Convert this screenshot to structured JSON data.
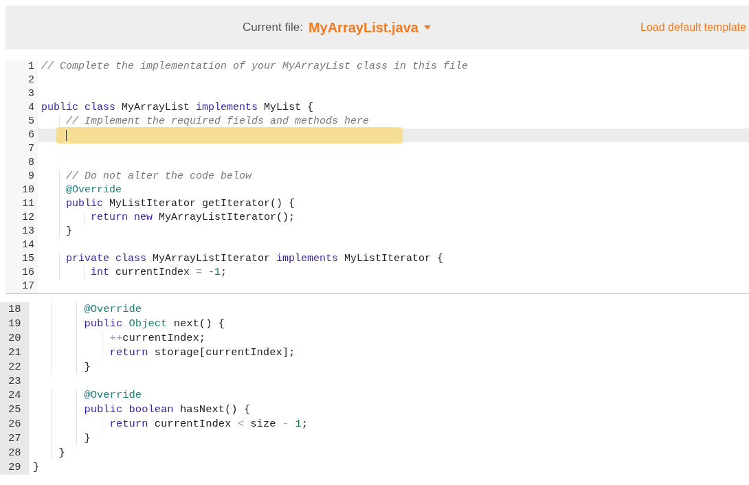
{
  "editor": {
    "current_file_label": "Current file:",
    "file_name": "MyArrayList.java",
    "template_link": "Load default template",
    "lines": [
      {
        "number": "1",
        "active": false,
        "highlighted": false,
        "tokens": [
          {
            "kind": "comment",
            "text": "// Complete the implementation of your MyArrayList class in this file"
          }
        ]
      },
      {
        "number": "2",
        "active": false,
        "highlighted": false
      },
      {
        "number": "3",
        "active": false,
        "highlighted": false
      },
      {
        "number": "4",
        "active": false,
        "highlighted": false,
        "tokens": [
          {
            "kind": "keyword",
            "text": "public class"
          },
          {
            "kind": "plain",
            "text": " MyArrayList "
          },
          {
            "kind": "keyword",
            "text": "implements"
          },
          {
            "kind": "plain",
            "text": " MyList {"
          }
        ]
      },
      {
        "number": "5",
        "active": false,
        "highlighted": false,
        "tokens": [
          {
            "kind": "comment",
            "text": "    // Implement the required fields and methods here"
          }
        ]
      },
      {
        "number": "6",
        "active": true,
        "highlighted": true
      },
      {
        "number": "7",
        "active": false,
        "highlighted": false
      },
      {
        "number": "8",
        "active": false,
        "highlighted": false
      },
      {
        "number": "9",
        "active": false,
        "highlighted": false,
        "tokens": [
          {
            "kind": "comment",
            "text": "    // Do not alter the code below"
          }
        ]
      },
      {
        "number": "10",
        "active": false,
        "highlighted": false,
        "tokens": [
          {
            "kind": "annotation",
            "text": "    @Override"
          }
        ]
      },
      {
        "number": "11",
        "active": false,
        "highlighted": false,
        "tokens": [
          {
            "kind": "keyword",
            "text": "    public"
          },
          {
            "kind": "plain",
            "text": " MyListIterator getIterator() {"
          }
        ]
      },
      {
        "number": "12",
        "active": false,
        "highlighted": false,
        "tokens": [
          {
            "kind": "keyword",
            "text": "        return new"
          },
          {
            "kind": "plain",
            "text": " MyArrayListIterator();"
          }
        ]
      },
      {
        "number": "13",
        "active": false,
        "highlighted": false,
        "tokens": [
          {
            "kind": "plain",
            "text": "    }"
          }
        ]
      },
      {
        "number": "14",
        "active": false,
        "highlighted": false
      },
      {
        "number": "15",
        "active": false,
        "highlighted": false,
        "tokens": [
          {
            "kind": "keyword",
            "text": "    private class"
          },
          {
            "kind": "plain",
            "text": " MyArrayListIterator "
          },
          {
            "kind": "keyword",
            "text": "implements"
          },
          {
            "kind": "plain",
            "text": " MyListIterator {"
          }
        ]
      },
      {
        "number": "16",
        "active": false,
        "highlighted": false,
        "tokens": [
          {
            "kind": "keyword",
            "text": "        int"
          },
          {
            "kind": "plain",
            "text": " currentIndex "
          },
          {
            "kind": "operator",
            "text": "= "
          },
          {
            "kind": "number",
            "text": "-1"
          },
          {
            "kind": "plain",
            "text": ";"
          }
        ]
      },
      {
        "number": "17",
        "active": false,
        "highlighted": false
      }
    ]
  },
  "continued_editor": {
    "lines": [
      {
        "number": "18",
        "tokens": [
          {
            "kind": "annotation",
            "text": "        @Override"
          }
        ]
      },
      {
        "number": "19",
        "tokens": [
          {
            "kind": "keyword",
            "text": "        public "
          },
          {
            "kind": "builtin",
            "text": "Object"
          },
          {
            "kind": "plain",
            "text": " next() {"
          }
        ]
      },
      {
        "number": "20",
        "tokens": [
          {
            "kind": "operator",
            "text": "            ++"
          },
          {
            "kind": "plain",
            "text": "currentIndex;"
          }
        ]
      },
      {
        "number": "21",
        "tokens": [
          {
            "kind": "keyword",
            "text": "            return"
          },
          {
            "kind": "plain",
            "text": " storage[currentIndex];"
          }
        ]
      },
      {
        "number": "22",
        "tokens": [
          {
            "kind": "plain",
            "text": "        }"
          }
        ]
      },
      {
        "number": "23"
      },
      {
        "number": "24",
        "tokens": [
          {
            "kind": "annotation",
            "text": "        @Override"
          }
        ]
      },
      {
        "number": "25",
        "tokens": [
          {
            "kind": "keyword",
            "text": "        public boolean"
          },
          {
            "kind": "plain",
            "text": " hasNext() {"
          }
        ]
      },
      {
        "number": "26",
        "tokens": [
          {
            "kind": "keyword",
            "text": "            return"
          },
          {
            "kind": "plain",
            "text": " currentIndex "
          },
          {
            "kind": "operator",
            "text": "<"
          },
          {
            "kind": "plain",
            "text": " size "
          },
          {
            "kind": "operator",
            "text": "- "
          },
          {
            "kind": "number",
            "text": "1"
          },
          {
            "kind": "plain",
            "text": ";"
          }
        ]
      },
      {
        "number": "27",
        "tokens": [
          {
            "kind": "plain",
            "text": "        }"
          }
        ]
      },
      {
        "number": "28",
        "tokens": [
          {
            "kind": "plain",
            "text": "    }"
          }
        ]
      },
      {
        "number": "29",
        "tokens": [
          {
            "kind": "plain",
            "text": "}"
          }
        ]
      }
    ]
  }
}
